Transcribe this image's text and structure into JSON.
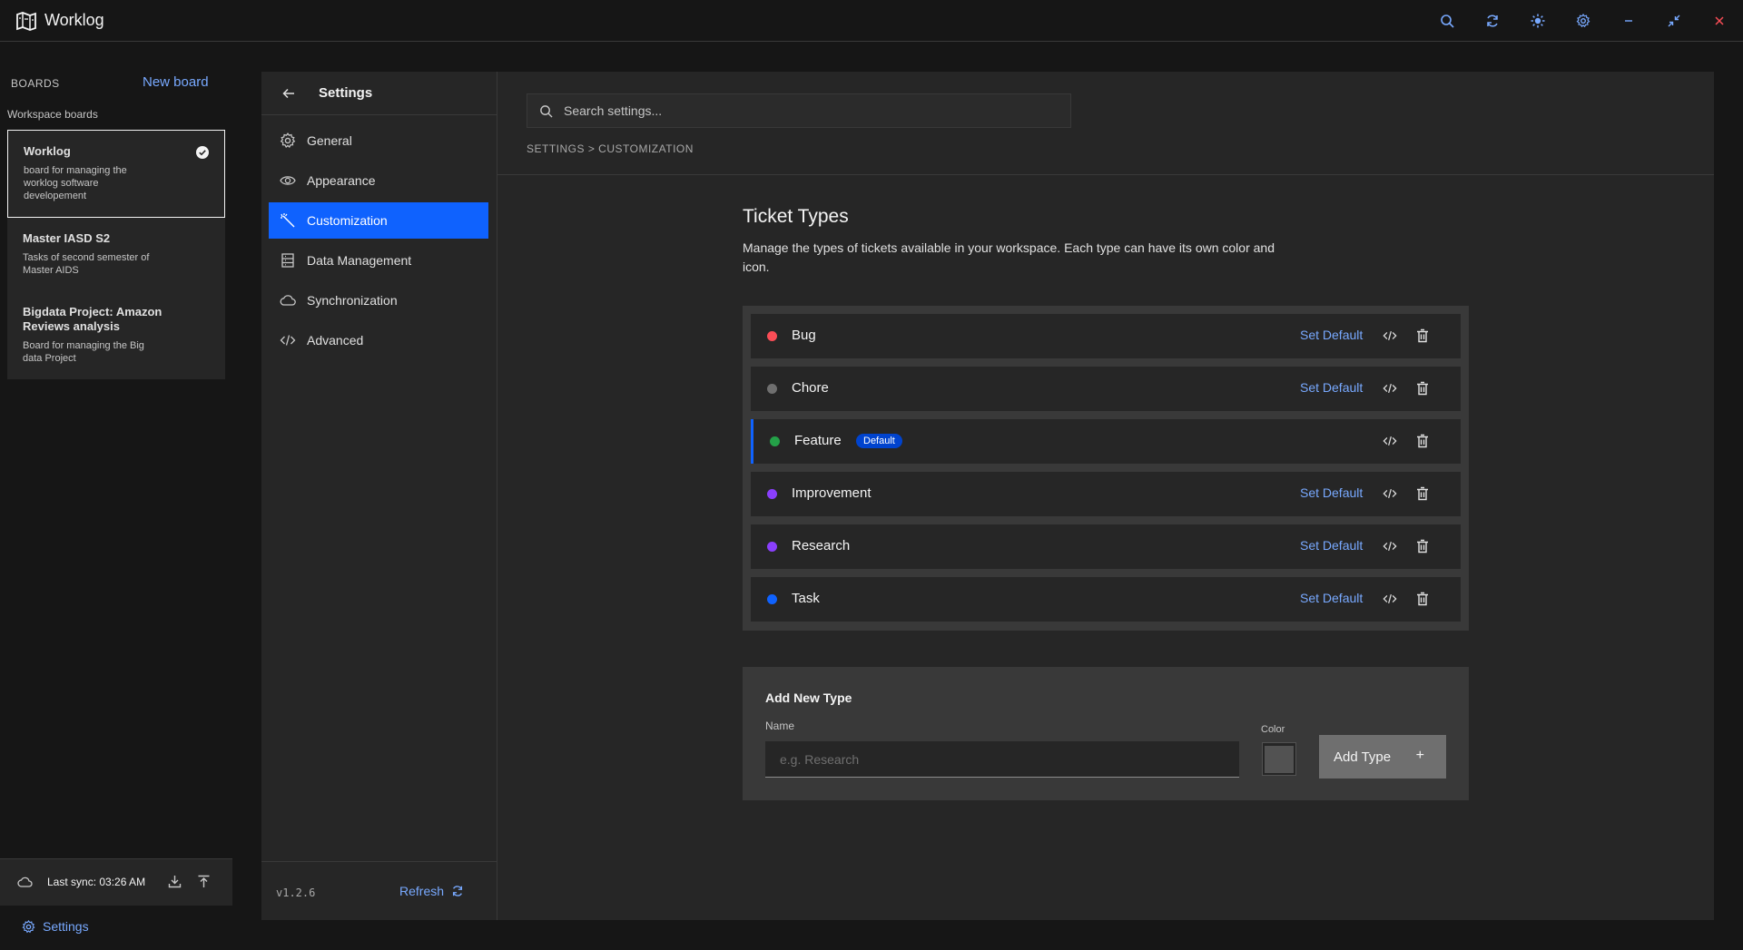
{
  "app": {
    "title": "Worklog"
  },
  "titlebar": {
    "icons": [
      "search-icon",
      "sync-icon",
      "theme-sun-icon",
      "gear-icon",
      "minimize-icon",
      "restore-icon",
      "close-icon"
    ]
  },
  "boards": {
    "heading": "BOARDS",
    "new_board_label": "New board",
    "workspace_label": "Workspace boards",
    "items": [
      {
        "title": "Worklog",
        "description": "board for managing the worklog software developement"
      },
      {
        "title": "Master IASD S2",
        "description": "Tasks of second semester of Master AIDS"
      },
      {
        "title": "Bigdata Project: Amazon Reviews analysis",
        "description": "Board for managing the Big data Project"
      }
    ],
    "sync_text": "Last sync: 03:26 AM",
    "settings_label": "Settings"
  },
  "settings_nav": {
    "title": "Settings",
    "items": [
      {
        "label": "General",
        "icon": "gear-icon"
      },
      {
        "label": "Appearance",
        "icon": "eye-icon"
      },
      {
        "label": "Customization",
        "icon": "wand-icon"
      },
      {
        "label": "Data Management",
        "icon": "database-icon"
      },
      {
        "label": "Synchronization",
        "icon": "cloud-icon"
      },
      {
        "label": "Advanced",
        "icon": "code-icon"
      }
    ],
    "version": "v1.2.6",
    "refresh_label": "Refresh"
  },
  "main": {
    "search_placeholder": "Search settings...",
    "breadcrumb": "SETTINGS > CUSTOMIZATION",
    "section_title": "Ticket Types",
    "section_description": "Manage the types of tickets available in your workspace. Each type can have its own color and icon.",
    "ticket_types": [
      {
        "name": "Bug",
        "color": "#fa4d56",
        "action": "Set Default"
      },
      {
        "name": "Chore",
        "color": "#6f6f6f",
        "action": "Set Default"
      },
      {
        "name": "Feature",
        "color": "#24a148",
        "badge": "Default"
      },
      {
        "name": "Improvement",
        "color": "#8a3ffc",
        "action": "Set Default"
      },
      {
        "name": "Research",
        "color": "#8a3ffc",
        "action": "Set Default"
      },
      {
        "name": "Task",
        "color": "#0f62fe",
        "action": "Set Default"
      }
    ],
    "add_panel": {
      "title": "Add New Type",
      "name_label": "Name",
      "name_placeholder": "e.g. Research",
      "color_label": "Color",
      "button_label": "Add Type",
      "button_icon": "+"
    }
  },
  "colors": {
    "accent": "#0f62fe",
    "link": "#78a9ff",
    "close": "#fa4d56"
  }
}
